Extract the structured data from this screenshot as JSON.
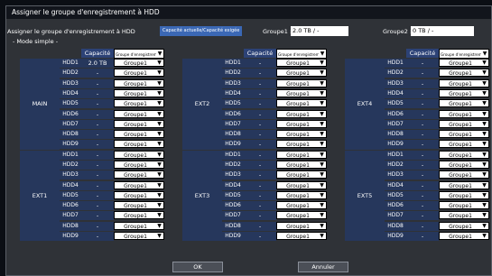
{
  "window": {
    "title": "Assigner le groupe d'enregistrement à HDD"
  },
  "header": {
    "label": "Assigner le groupe d'enregistrement à HDD",
    "badge": "Capacité actuelle/Capacité exigée",
    "group1_label": "Groupe1 :",
    "group1_value": "2.0  TB / -",
    "group2_label": "Groupe2 :",
    "group2_value": "0  TB / -"
  },
  "mode_label": "- Mode simple -",
  "columns": {
    "capacity": "Capacité",
    "group": "Groupe d'enregistrement"
  },
  "panels": [
    {
      "top": {
        "name": "MAIN",
        "rows": [
          {
            "hdd": "HDD1",
            "cap": "2.0 TB",
            "group": "Groupe1"
          },
          {
            "hdd": "HDD2",
            "cap": "-",
            "group": "Groupe1"
          },
          {
            "hdd": "HDD3",
            "cap": "-",
            "group": "Groupe1"
          },
          {
            "hdd": "HDD4",
            "cap": "-",
            "group": "Groupe1"
          },
          {
            "hdd": "HDD5",
            "cap": "-",
            "group": "Groupe1"
          },
          {
            "hdd": "HDD6",
            "cap": "-",
            "group": "Groupe1"
          },
          {
            "hdd": "HDD7",
            "cap": "-",
            "group": "Groupe1"
          },
          {
            "hdd": "HDD8",
            "cap": "-",
            "group": "Groupe1"
          },
          {
            "hdd": "HDD9",
            "cap": "-",
            "group": "Groupe1"
          }
        ]
      },
      "bottom": {
        "name": "EXT1",
        "rows": [
          {
            "hdd": "HDD1",
            "cap": "-",
            "group": "Groupe1"
          },
          {
            "hdd": "HDD2",
            "cap": "-",
            "group": "Groupe1"
          },
          {
            "hdd": "HDD3",
            "cap": "-",
            "group": "Groupe1"
          },
          {
            "hdd": "HDD4",
            "cap": "-",
            "group": "Groupe1"
          },
          {
            "hdd": "HDD5",
            "cap": "-",
            "group": "Groupe1"
          },
          {
            "hdd": "HDD6",
            "cap": "-",
            "group": "Groupe1"
          },
          {
            "hdd": "HDD7",
            "cap": "-",
            "group": "Groupe1"
          },
          {
            "hdd": "HDD8",
            "cap": "-",
            "group": "Groupe1"
          },
          {
            "hdd": "HDD9",
            "cap": "-",
            "group": "Groupe1"
          }
        ]
      }
    },
    {
      "top": {
        "name": "EXT2",
        "rows": [
          {
            "hdd": "HDD1",
            "cap": "-",
            "group": "Groupe1"
          },
          {
            "hdd": "HDD2",
            "cap": "-",
            "group": "Groupe1"
          },
          {
            "hdd": "HDD3",
            "cap": "-",
            "group": "Groupe1"
          },
          {
            "hdd": "HDD4",
            "cap": "-",
            "group": "Groupe1"
          },
          {
            "hdd": "HDD5",
            "cap": "-",
            "group": "Groupe1"
          },
          {
            "hdd": "HDD6",
            "cap": "-",
            "group": "Groupe1"
          },
          {
            "hdd": "HDD7",
            "cap": "-",
            "group": "Groupe1"
          },
          {
            "hdd": "HDD8",
            "cap": "-",
            "group": "Groupe1"
          },
          {
            "hdd": "HDD9",
            "cap": "-",
            "group": "Groupe1"
          }
        ]
      },
      "bottom": {
        "name": "EXT3",
        "rows": [
          {
            "hdd": "HDD1",
            "cap": "-",
            "group": "Groupe1"
          },
          {
            "hdd": "HDD2",
            "cap": "-",
            "group": "Groupe1"
          },
          {
            "hdd": "HDD3",
            "cap": "-",
            "group": "Groupe1"
          },
          {
            "hdd": "HDD4",
            "cap": "-",
            "group": "Groupe1"
          },
          {
            "hdd": "HDD5",
            "cap": "-",
            "group": "Groupe1"
          },
          {
            "hdd": "HDD6",
            "cap": "-",
            "group": "Groupe1"
          },
          {
            "hdd": "HDD7",
            "cap": "-",
            "group": "Groupe1"
          },
          {
            "hdd": "HDD8",
            "cap": "-",
            "group": "Groupe1"
          },
          {
            "hdd": "HDD9",
            "cap": "-",
            "group": "Groupe1"
          }
        ]
      }
    },
    {
      "top": {
        "name": "EXT4",
        "rows": [
          {
            "hdd": "HDD1",
            "cap": "-",
            "group": "Groupe1"
          },
          {
            "hdd": "HDD2",
            "cap": "-",
            "group": "Groupe1"
          },
          {
            "hdd": "HDD3",
            "cap": "-",
            "group": "Groupe1"
          },
          {
            "hdd": "HDD4",
            "cap": "-",
            "group": "Groupe1"
          },
          {
            "hdd": "HDD5",
            "cap": "-",
            "group": "Groupe1"
          },
          {
            "hdd": "HDD6",
            "cap": "-",
            "group": "Groupe1"
          },
          {
            "hdd": "HDD7",
            "cap": "-",
            "group": "Groupe1"
          },
          {
            "hdd": "HDD8",
            "cap": "-",
            "group": "Groupe1"
          },
          {
            "hdd": "HDD9",
            "cap": "-",
            "group": "Groupe1"
          }
        ]
      },
      "bottom": {
        "name": "EXT5",
        "rows": [
          {
            "hdd": "HDD1",
            "cap": "-",
            "group": "Groupe1"
          },
          {
            "hdd": "HDD2",
            "cap": "-",
            "group": "Groupe1"
          },
          {
            "hdd": "HDD3",
            "cap": "-",
            "group": "Groupe1"
          },
          {
            "hdd": "HDD4",
            "cap": "-",
            "group": "Groupe1"
          },
          {
            "hdd": "HDD5",
            "cap": "-",
            "group": "Groupe1"
          },
          {
            "hdd": "HDD6",
            "cap": "-",
            "group": "Groupe1"
          },
          {
            "hdd": "HDD7",
            "cap": "-",
            "group": "Groupe1"
          },
          {
            "hdd": "HDD8",
            "cap": "-",
            "group": "Groupe1"
          },
          {
            "hdd": "HDD9",
            "cap": "-",
            "group": "Groupe1"
          }
        ]
      }
    }
  ],
  "buttons": {
    "ok": "OK",
    "cancel": "Annuler"
  },
  "icons": {
    "dropdown": "chevron-down-icon"
  },
  "colors": {
    "accent": "#3b68b5",
    "cell_bg": "#26375c",
    "window_bg": "#2f3237"
  }
}
